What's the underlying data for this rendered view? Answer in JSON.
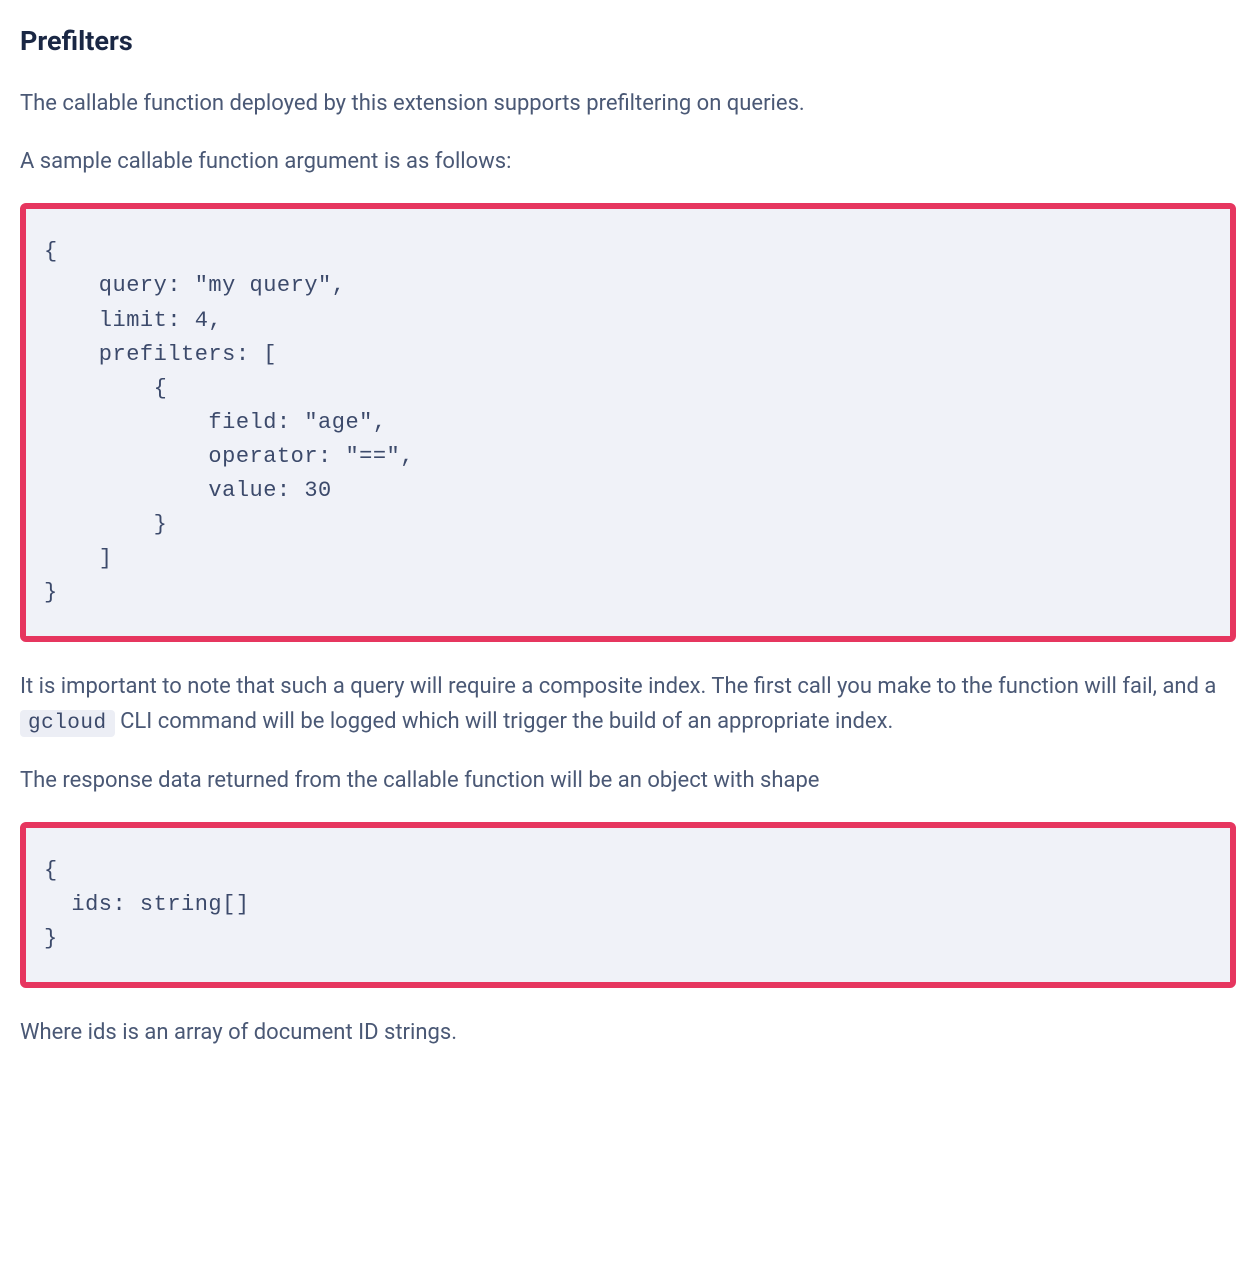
{
  "heading": "Prefilters",
  "paragraph_1": "The callable function deployed by this extension supports prefiltering on queries.",
  "paragraph_2": "A sample callable function argument is as follows:",
  "code_block_1": "{\n    query: \"my query\",\n    limit: 4,\n    prefilters: [\n        {\n            field: \"age\",\n            operator: \"==\",\n            value: 30\n        }\n    ]\n}",
  "paragraph_3_part_1": "It is important to note that such a query will require a composite index. The first call you make to the function will fail, and a ",
  "paragraph_3_code": "gcloud",
  "paragraph_3_part_2": " CLI command will be logged which will trigger the build of an appropriate index.",
  "paragraph_4": "The response data returned from the callable function will be an object with shape",
  "code_block_2": "{\n  ids: string[]\n}",
  "paragraph_5": "Where ids is an array of document ID strings."
}
